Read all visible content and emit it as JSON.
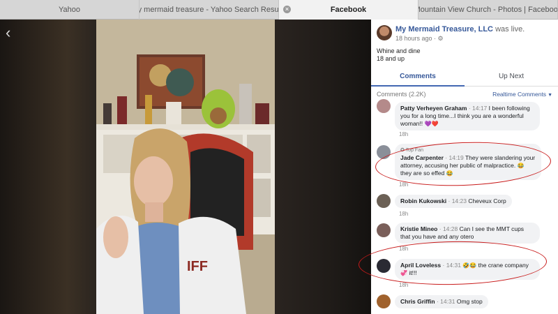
{
  "tabs": [
    {
      "label": "Yahoo"
    },
    {
      "label": "my mermaid treasure - Yahoo Search Results"
    },
    {
      "label": "Facebook",
      "close_glyph": "×"
    },
    {
      "label": "Mountain View Church - Photos | Facebook"
    }
  ],
  "video": {
    "back_glyph": "‹"
  },
  "post": {
    "page_name": "My Mermaid Treasure, LLC",
    "was_live": "was live.",
    "time": "18 hours ago",
    "gear_glyph": "⚙",
    "text_line1": "Whine and dine",
    "text_line2": "18 and up"
  },
  "panel_tabs": {
    "comments": "Comments",
    "up_next": "Up Next"
  },
  "comments_header": {
    "count": "Comments (2.2K)",
    "sort": "Realtime Comments",
    "caret": "▼"
  },
  "comments": [
    {
      "name": "Patty Verheyen Graham",
      "time": "14:17",
      "text": "I been following you for a long time...I think you are a wonderful woman!!",
      "emoji": "💜❤️",
      "age": "18h",
      "avatar_color": "#b48a8a"
    },
    {
      "badge": "✪ Top Fan",
      "name": "Jade Carpenter",
      "time": "14:19",
      "text_a": "They were slandering your attorney, accusing her public of malpractice.",
      "emoji_a": "😂",
      "text_b": "they are so effed",
      "emoji_b": "😂",
      "age": "18h",
      "avatar_color": "#8a8f99"
    },
    {
      "name": "Robin Kukowski",
      "time": "14:23",
      "text": "Cheveux Corp",
      "age": "18h",
      "avatar_color": "#6b6055"
    },
    {
      "name": "Kristie Mineo",
      "time": "14:28",
      "text": "Can I see the MMT cups that you have and any otero",
      "age": "18h",
      "avatar_color": "#7a5f5a"
    },
    {
      "name": "April Loveless",
      "time": "14:31",
      "emoji_a": "🤣😂",
      "text": "the crane company",
      "emoji_b": "💞",
      "text_b": "it!!!",
      "age": "18h",
      "avatar_color": "#2a2a33"
    },
    {
      "name": "Chris Griffin",
      "time": "14:31",
      "text": "Omg stop",
      "age": "18h",
      "avatar_color": "#a0622d"
    }
  ],
  "colors": {
    "accent": "#4267b2",
    "link": "#365899",
    "annotation_red": "#c81a1a"
  }
}
